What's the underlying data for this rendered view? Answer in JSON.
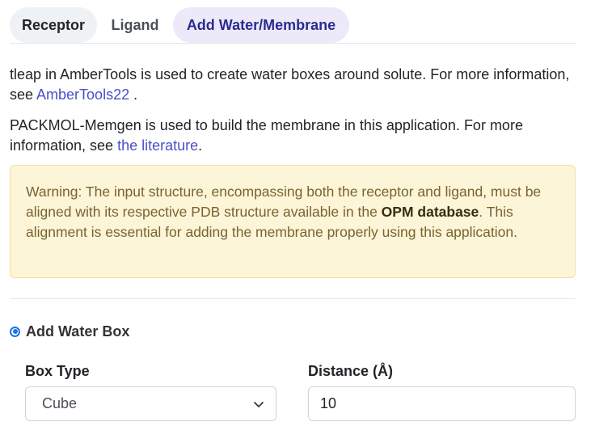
{
  "tabs": {
    "receptor": "Receptor",
    "ligand": "Ligand",
    "water_membrane": "Add Water/Membrane",
    "active": "Add Water/Membrane"
  },
  "intro": {
    "p1_text": "tleap in AmberTools is used to create water boxes around solute. For more information, see ",
    "p1_link": "AmberTools22",
    "p1_tail": " .",
    "p2_text": "PACKMOL-Memgen is used to build the membrane in this application. For more information, see ",
    "p2_link": "the literature",
    "p2_tail": "."
  },
  "warning": {
    "text_before": "Warning: The input structure, encompassing both the receptor and ligand, must be aligned with its respective PDB structure available in the ",
    "bold": "OPM database",
    "text_after": ". This alignment is essential for adding the membrane properly using this application."
  },
  "water_box": {
    "option_label": "Add Water Box",
    "selected": true,
    "box_type_label": "Box Type",
    "box_type_value": "Cube",
    "distance_label": "Distance (Å)",
    "distance_value": "10"
  },
  "colors": {
    "link": "#4b4fc8",
    "active_tab_bg": "#eceaf9",
    "warning_bg": "#fcf5d7",
    "radio": "#1a73e8"
  }
}
